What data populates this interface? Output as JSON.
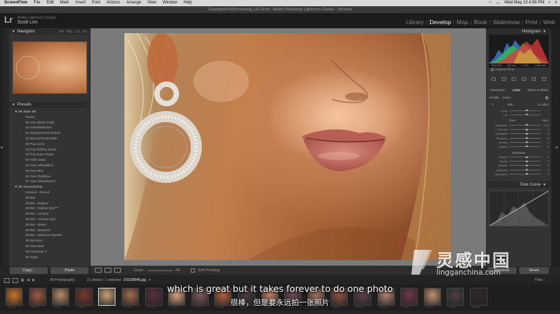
{
  "menubar": {
    "items": [
      "ScreenFlow",
      "File",
      "Edit",
      "Mark",
      "Insert",
      "Font",
      "Actions",
      "Arrange",
      "View",
      "Window",
      "Help"
    ],
    "clock": "Wed May 13 4:56 PM"
  },
  "window_title": "ExamplesPostProcessing_LR-Circle - Adobe Photoshop Lightroom Classic - Develop",
  "identity": {
    "logo": "Lr",
    "line1": "Adobe Lightroom Classic",
    "line2": "Scott Lim"
  },
  "modules": [
    "Library",
    "Develop",
    "Map",
    "Book",
    "Slideshow",
    "Print",
    "Web"
  ],
  "active_module": "Develop",
  "left_panel": {
    "navigator_title": "Navigator",
    "navigator_opts": [
      "FIT",
      "FILL",
      "1:1",
      "3:1"
    ],
    "presets_title": "Presets",
    "presets": [
      {
        "type": "folder",
        "label": "08. Base Set"
      },
      {
        "type": "item",
        "label": "Preset"
      },
      {
        "type": "item",
        "label": "00 Auto (Reset Fold)"
      },
      {
        "type": "item",
        "label": "01 NoiseReduction"
      },
      {
        "type": "item",
        "label": "02 SkinnyPortrait Vertical"
      },
      {
        "type": "item",
        "label": "02 SkinnyPortrait Wide"
      },
      {
        "type": "item",
        "label": "03 Pop Curve"
      },
      {
        "type": "item",
        "label": "03 Pop Midtone Bump"
      },
      {
        "type": "item",
        "label": "03 Pop Super Duper"
      },
      {
        "type": "item",
        "label": "04 HDR Clean"
      },
      {
        "type": "item",
        "label": "05 Tone Yellow/Blue"
      },
      {
        "type": "item",
        "label": "06 Tone Blue"
      },
      {
        "type": "item",
        "label": "06 Tone Pink/Blue"
      },
      {
        "type": "item",
        "label": "07 Tone Yellow/Green"
      },
      {
        "type": "folder",
        "label": "08. MonoChrome"
      },
      {
        "type": "item",
        "label": "General - Zeroed"
      },
      {
        "type": "item",
        "label": "59 BW"
      },
      {
        "type": "item",
        "label": "59 BW - brighter"
      },
      {
        "type": "item",
        "label": "59 BW - brighter plus***"
      },
      {
        "type": "item",
        "label": "59 BW - contrast"
      },
      {
        "type": "item",
        "label": "59 BW - contrast high"
      },
      {
        "type": "item",
        "label": "59 BW - darker"
      },
      {
        "type": "item",
        "label": "59 BW - Washout"
      },
      {
        "type": "item",
        "label": "59 BW - Washout Vignette"
      },
      {
        "type": "item",
        "label": "59 BW silver"
      },
      {
        "type": "item",
        "label": "59 Chocolate"
      },
      {
        "type": "item",
        "label": "59 Chocolate 2"
      },
      {
        "type": "item",
        "label": "59 Sepia"
      }
    ],
    "copy_label": "Copy...",
    "paste_label": "Paste"
  },
  "toolbar": {
    "zoom_label": "Zoom",
    "zoom_value": "Fit",
    "softproof_label": "Soft Proofing"
  },
  "right_panel": {
    "histogram_title": "Histogram",
    "hist_numbers": [
      "ISO 200",
      "50 mm",
      "f / 5.6",
      "1/200 sec"
    ],
    "original_photo": "Original Photo",
    "treatment": [
      "Treatment:",
      "Color",
      "Black & White"
    ],
    "treatment_selected": "Color",
    "profile_label": "Profile:",
    "profile_value": "Color",
    "wb_label": "WB:",
    "wb_value": "As Shot",
    "sliders_wb": [
      {
        "label": "Temp",
        "value": ""
      },
      {
        "label": "Tint",
        "value": ""
      }
    ],
    "tone_label": "Tone",
    "tone_auto": "Auto",
    "sliders_tone": [
      {
        "label": "Exposure",
        "value": "0.00"
      },
      {
        "label": "Contrast",
        "value": "0"
      },
      {
        "label": "Highlights",
        "value": "0"
      },
      {
        "label": "Shadows",
        "value": "0"
      },
      {
        "label": "Whites",
        "value": "0"
      },
      {
        "label": "Blacks",
        "value": "0"
      }
    ],
    "presence_label": "Presence",
    "sliders_presence": [
      {
        "label": "Texture",
        "value": "0"
      },
      {
        "label": "Clarity",
        "value": "0"
      },
      {
        "label": "Dehaze",
        "value": "0"
      },
      {
        "label": "Vibrance",
        "value": "0"
      },
      {
        "label": "Saturation",
        "value": "0"
      }
    ],
    "tone_curve_title": "Tone Curve",
    "previous_label": "Previous",
    "reset_label": "Reset"
  },
  "filmstrip_bar": {
    "source": "All Photographs",
    "count": "21 photos / 1 selected",
    "file": "DSC08845.jpg",
    "filter_label": "Filter :"
  },
  "captions": {
    "english": "which is great but it takes forever to do one photo",
    "chinese": "很棒，但是要永远拍一张照片"
  },
  "watermark": {
    "title": "灵感中国",
    "url": "lingganchina.com"
  },
  "colors": {
    "panel_bg": "#333333",
    "active_module": "#f2f2f2",
    "caption": "#ffffff"
  }
}
